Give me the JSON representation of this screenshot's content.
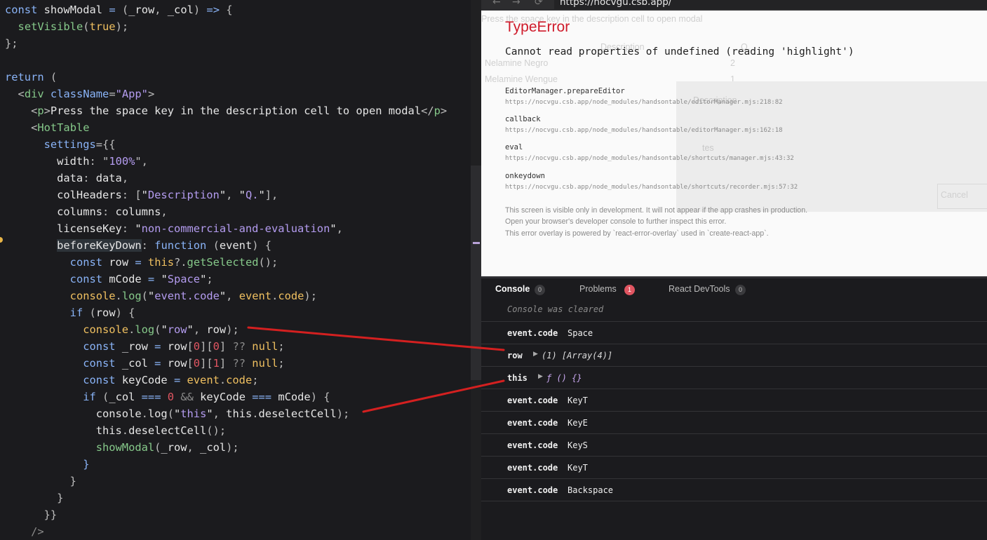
{
  "editor": {
    "lines": [
      "const showModal = (_row, _col) => {",
      "  setVisible(true);",
      "};",
      "",
      "return (",
      "  <div className=\"App\">",
      "    <p>Press the space key in the description cell to open modal</p>",
      "    <HotTable",
      "      settings={{",
      "        width: \"100%\",",
      "        data: data,",
      "        colHeaders: [\"Description\", \"Q.\"],",
      "        columns: columns,",
      "        licenseKey: \"non-commercial-and-evaluation\",",
      "        beforeKeyDown: function (event) {",
      "          const row = this?.getSelected();",
      "          const mCode = \"Space\";",
      "          console.log(\"event.code\", event.code);",
      "          if (row) {",
      "            console.log(\"row\", row);",
      "            const _row = row[0][0] ?? null;",
      "            const _col = row[0][1] ?? null;",
      "            const keyCode = event.code;",
      "            if (_col === 0 && keyCode === mCode) {",
      "              console.log(\"this\", this.deselectCell);",
      "              this.deselectCell();",
      "              showModal(_row, _col);",
      "            }",
      "          }",
      "        }",
      "      }}",
      "    />"
    ]
  },
  "browser": {
    "url": "https://nocvgu.csb.app/",
    "back_icon": "arrow-left",
    "forward_icon": "arrow-right",
    "reload_icon": "reload"
  },
  "faded_app": {
    "paragraph": "Press the space key in the description cell to open modal",
    "col_description": "Description",
    "col_q": "Q.",
    "row1": "Nelamine Negro",
    "row2": "Melamine Wengue",
    "row1_q": "2",
    "row2_q": "1",
    "modal_label": "Description",
    "modal_input": "tes",
    "modal_cancel": "Cancel"
  },
  "error_overlay": {
    "title": "TypeError",
    "message": "Cannot read properties of undefined (reading 'highlight')",
    "frames": [
      {
        "fn": "EditorManager.prepareEditor",
        "path": "https://nocvgu.csb.app/node_modules/handsontable/editorManager.mjs:218:82"
      },
      {
        "fn": "callback",
        "path": "https://nocvgu.csb.app/node_modules/handsontable/editorManager.mjs:162:18"
      },
      {
        "fn": "eval",
        "path": "https://nocvgu.csb.app/node_modules/handsontable/shortcuts/manager.mjs:43:32"
      },
      {
        "fn": "onkeydown",
        "path": "https://nocvgu.csb.app/node_modules/handsontable/shortcuts/recorder.mjs:57:32"
      }
    ],
    "notes": [
      "This screen is visible only in development. It will not appear if the app crashes in production.",
      "Open your browser's developer console to further inspect this error.",
      "This error overlay is powered by `react-error-overlay` used in `create-react-app`."
    ]
  },
  "devtools": {
    "tabs": [
      {
        "label": "Console",
        "badge": "0"
      },
      {
        "label": "Problems",
        "badge": "1"
      },
      {
        "label": "React DevTools",
        "badge": "0"
      }
    ],
    "cleared": "Console was cleared",
    "logs": [
      {
        "key": "event.code",
        "value": "Space"
      },
      {
        "key": "row",
        "value": "(1) [Array(4)]"
      },
      {
        "key": "this",
        "value": "ƒ () {}"
      },
      {
        "key": "event.code",
        "value": "KeyT"
      },
      {
        "key": "event.code",
        "value": "KeyE"
      },
      {
        "key": "event.code",
        "value": "KeyS"
      },
      {
        "key": "event.code",
        "value": "KeyT"
      },
      {
        "key": "event.code",
        "value": "Backspace"
      }
    ]
  },
  "colors": {
    "error_red": "#cf1b2b",
    "annotation_red": "#d42020",
    "problems_badge": "#e05561"
  }
}
